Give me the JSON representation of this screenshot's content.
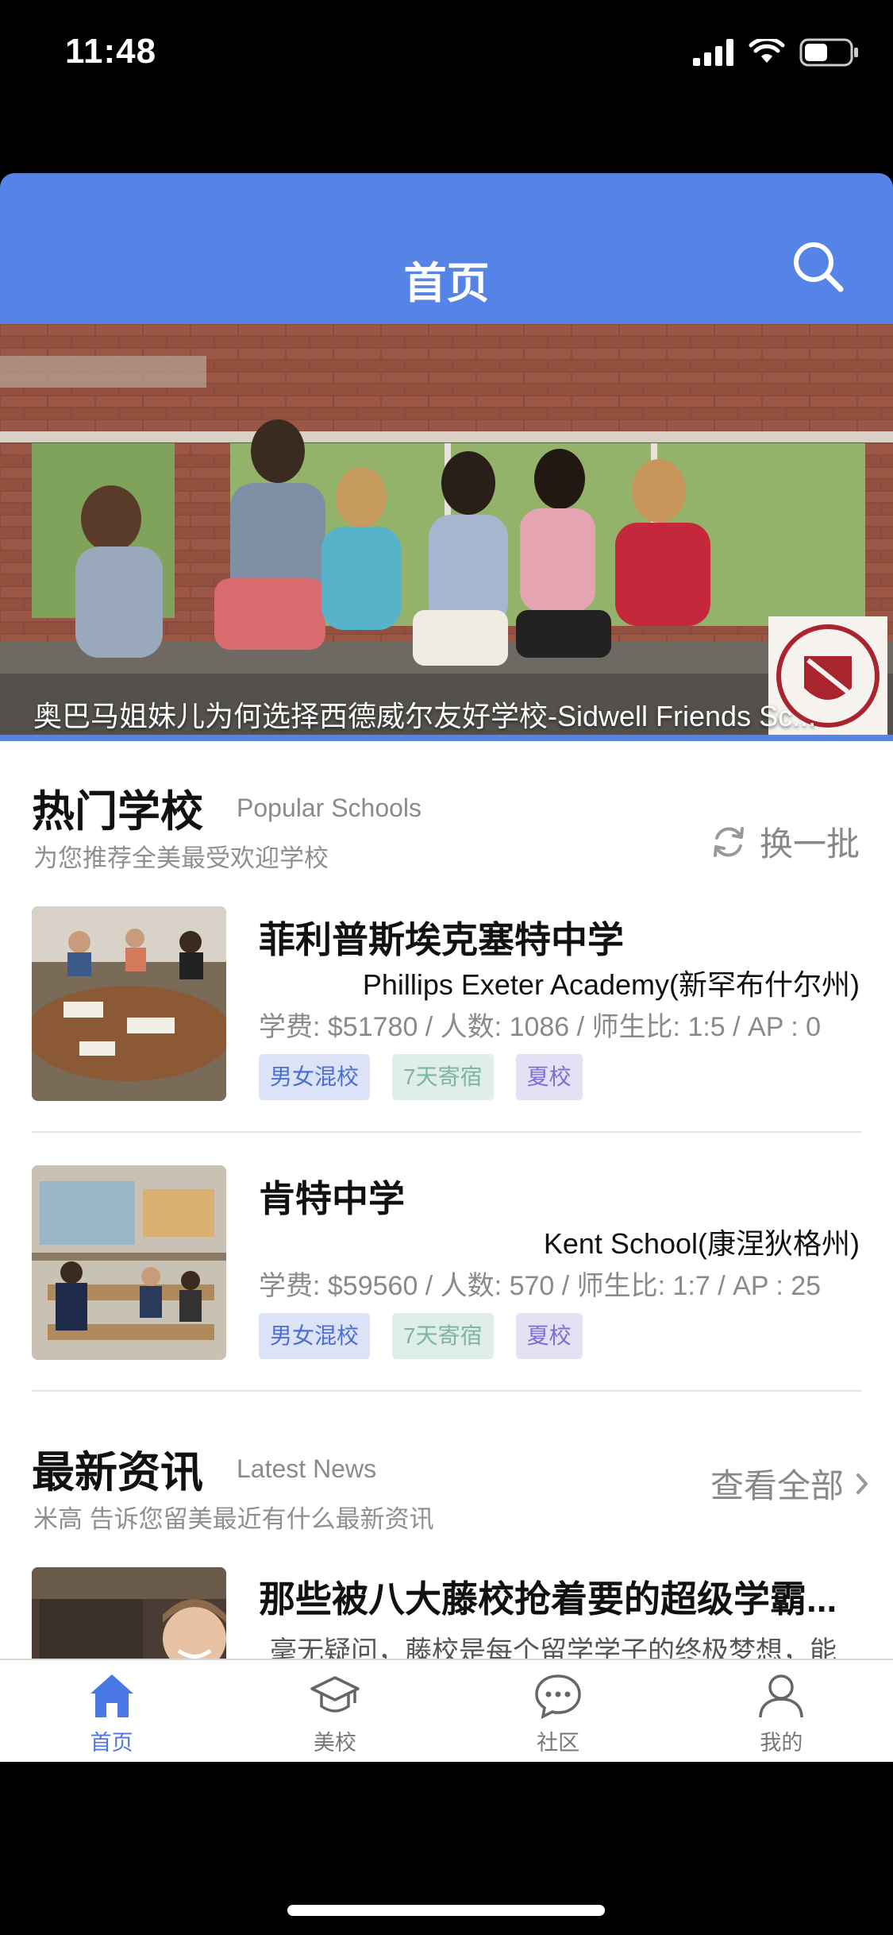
{
  "status_bar": {
    "time": "11:48"
  },
  "navbar": {
    "title": "首页"
  },
  "banner": {
    "caption": "奥巴马姐妹儿为何选择西德威尔友好学校-Sidwell Friends Sc..."
  },
  "popular": {
    "title": "热门学校",
    "title_en": "Popular Schools",
    "subtitle": "为您推荐全美最受欢迎学校",
    "action": "换一批",
    "schools": [
      {
        "name": "菲利普斯埃克塞特中学",
        "name_en": "Phillips Exeter Academy(新罕布什尔州)",
        "stats": "学费: $51780 / 人数: 1086 / 师生比: 1:5 / AP : 0",
        "tags": [
          "男女混校",
          "7天寄宿",
          "夏校"
        ]
      },
      {
        "name": "肯特中学",
        "name_en": "Kent School(康涅狄格州)",
        "stats": "学费: $59560 / 人数: 570 / 师生比: 1:7 / AP : 25",
        "tags": [
          "男女混校",
          "7天寄宿",
          "夏校"
        ]
      }
    ]
  },
  "news": {
    "title": "最新资讯",
    "title_en": "Latest News",
    "subtitle": "米高 告诉您留美最近有什么最新资讯",
    "action": "查看全部",
    "items": [
      {
        "title": "那些被八大藤校抢着要的超级学霸...",
        "summary": "毫无疑问，藤校是每个留学学子的终极梦想，能"
      }
    ]
  },
  "tabbar": {
    "items": [
      {
        "label": "首页",
        "icon": "home-icon",
        "active": true
      },
      {
        "label": "美校",
        "icon": "graduation-cap-icon",
        "active": false
      },
      {
        "label": "社区",
        "icon": "chat-icon",
        "active": false
      },
      {
        "label": "我的",
        "icon": "user-icon",
        "active": false
      }
    ]
  },
  "colors": {
    "brand": "#5683E6",
    "tab_active": "#4A78E4"
  }
}
